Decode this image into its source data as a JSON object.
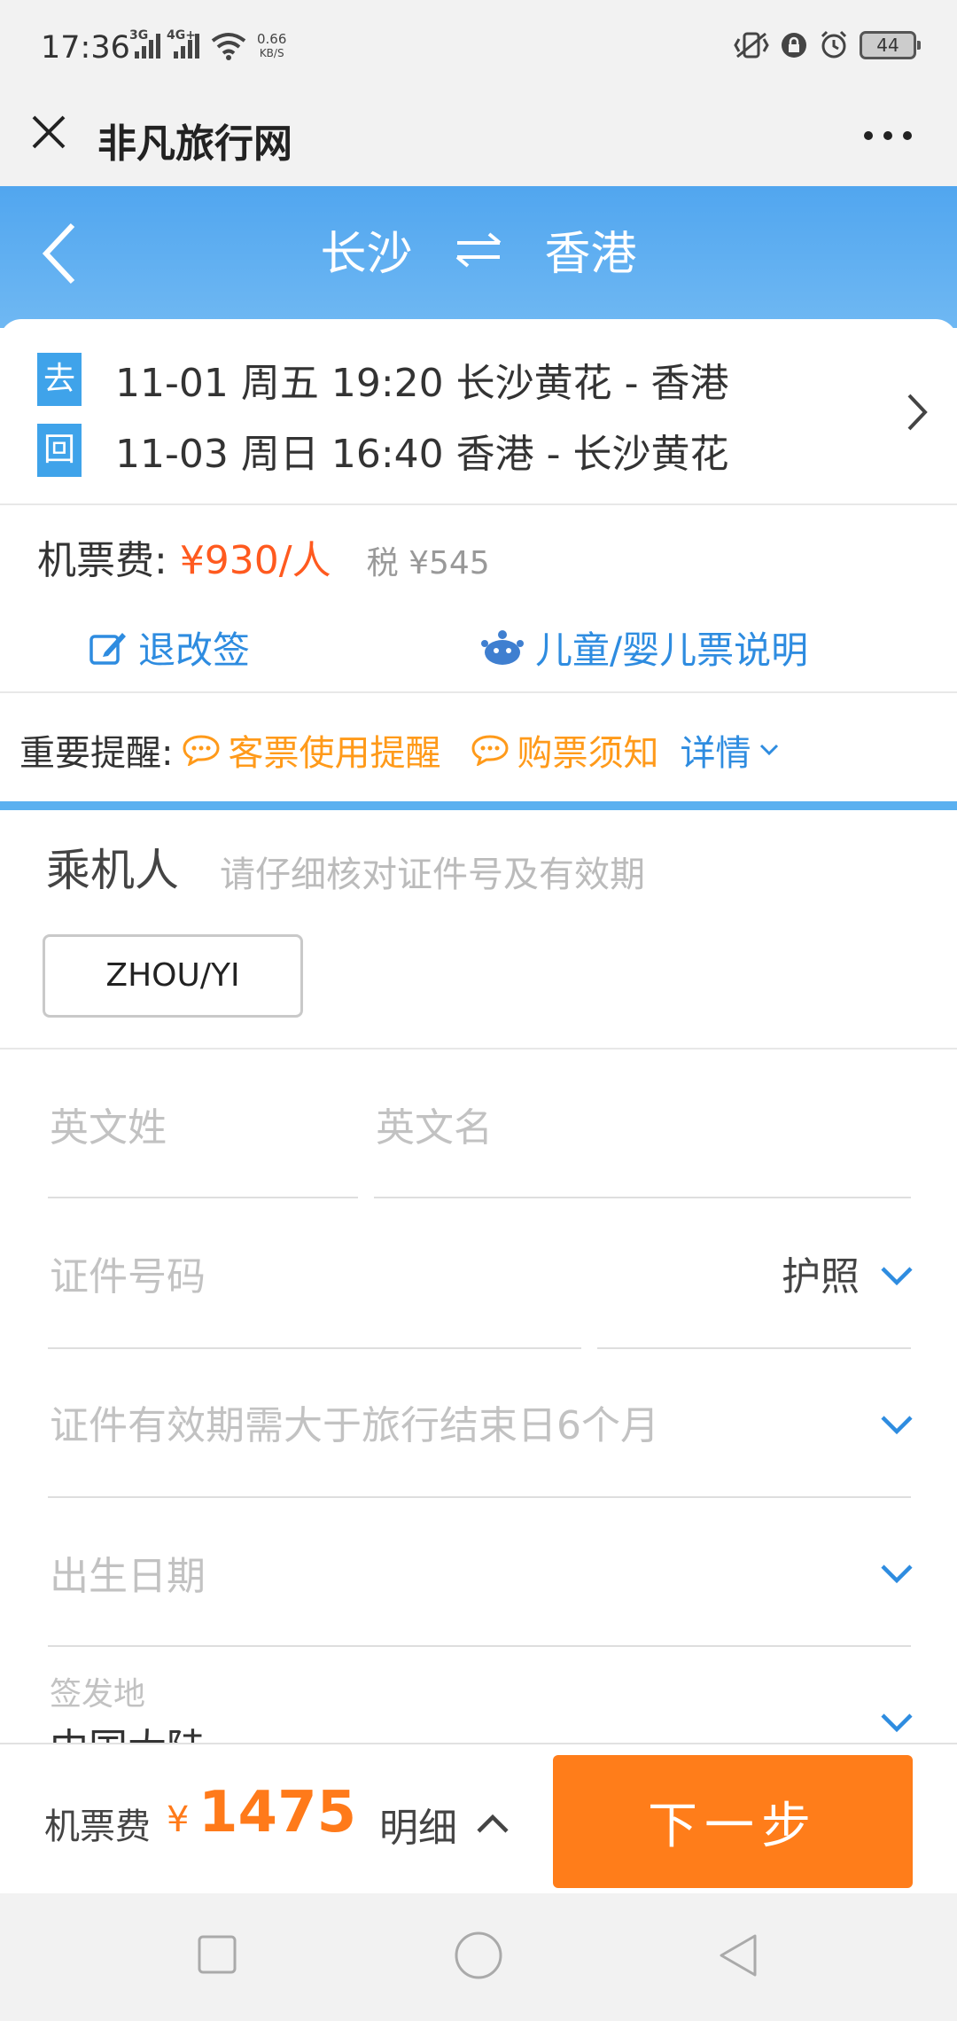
{
  "status_bar": {
    "time": "17:36",
    "net1": "3G",
    "net2": "4G+",
    "speed_value": "0.66",
    "speed_unit": "KB/S",
    "battery": "44"
  },
  "app_header": {
    "title": "非凡旅行网"
  },
  "banner": {
    "from": "长沙",
    "to": "香港",
    "color": "#51a6ef"
  },
  "flights": [
    {
      "tag": "去",
      "text": "11-01 周五 19:20 长沙黄花 - 香港"
    },
    {
      "tag": "回",
      "text": "11-03 周日 16:40 香港 - 长沙黄花"
    }
  ],
  "fare": {
    "label": "机票费: ",
    "price": "¥930/人",
    "tax": "税 ¥545",
    "refund_link": "退改签",
    "child_link": "儿童/婴儿票说明"
  },
  "reminder": {
    "label": "重要提醒:",
    "items": [
      "客票使用提醒",
      "购票须知"
    ],
    "more": "详情"
  },
  "passenger": {
    "title": "乘机人",
    "hint": "请仔细核对证件号及有效期",
    "selected": "ZHOU/YI"
  },
  "form": {
    "surname_placeholder": "英文姓",
    "given_placeholder": "英文名",
    "id_placeholder": "证件号码",
    "id_type": "护照",
    "expiry_placeholder": "证件有效期需大于旅行结束日6个月",
    "birth_placeholder": "出生日期",
    "issue_label": "签发地",
    "issue_value": "中国大陆"
  },
  "bottom": {
    "label": "机票费",
    "currency": "¥",
    "total": "1475",
    "detail": "明细",
    "next": "下一步",
    "accent": "#ff7d1a"
  }
}
